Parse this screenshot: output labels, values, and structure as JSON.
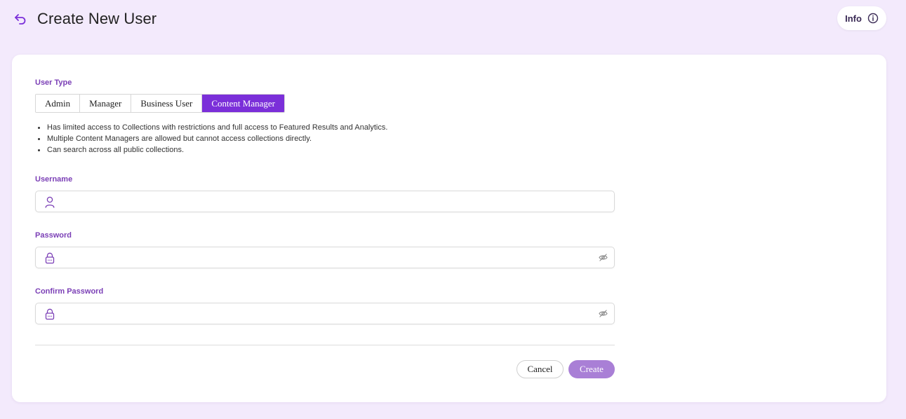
{
  "header": {
    "title": "Create New User",
    "info_label": "Info"
  },
  "form": {
    "user_type": {
      "label": "User Type",
      "options": [
        "Admin",
        "Manager",
        "Business User",
        "Content Manager"
      ],
      "selected": "Content Manager"
    },
    "description": [
      "Has limited access to Collections with restrictions and full access to Featured Results and Analytics.",
      "Multiple Content Managers are allowed but cannot access collections directly.",
      "Can search across all public collections."
    ],
    "username": {
      "label": "Username",
      "value": "",
      "icon": "user-icon"
    },
    "password": {
      "label": "Password",
      "value": "",
      "icon": "lock-icon",
      "toggle_icon": "eye-off-icon"
    },
    "confirm_password": {
      "label": "Confirm Password",
      "value": "",
      "icon": "lock-icon",
      "toggle_icon": "eye-off-icon"
    }
  },
  "actions": {
    "cancel_label": "Cancel",
    "create_label": "Create"
  },
  "colors": {
    "accent": "#7b2fd9",
    "label": "#7b3fb6",
    "create_disabled": "#a97fd6",
    "background": "#f3eafc"
  }
}
